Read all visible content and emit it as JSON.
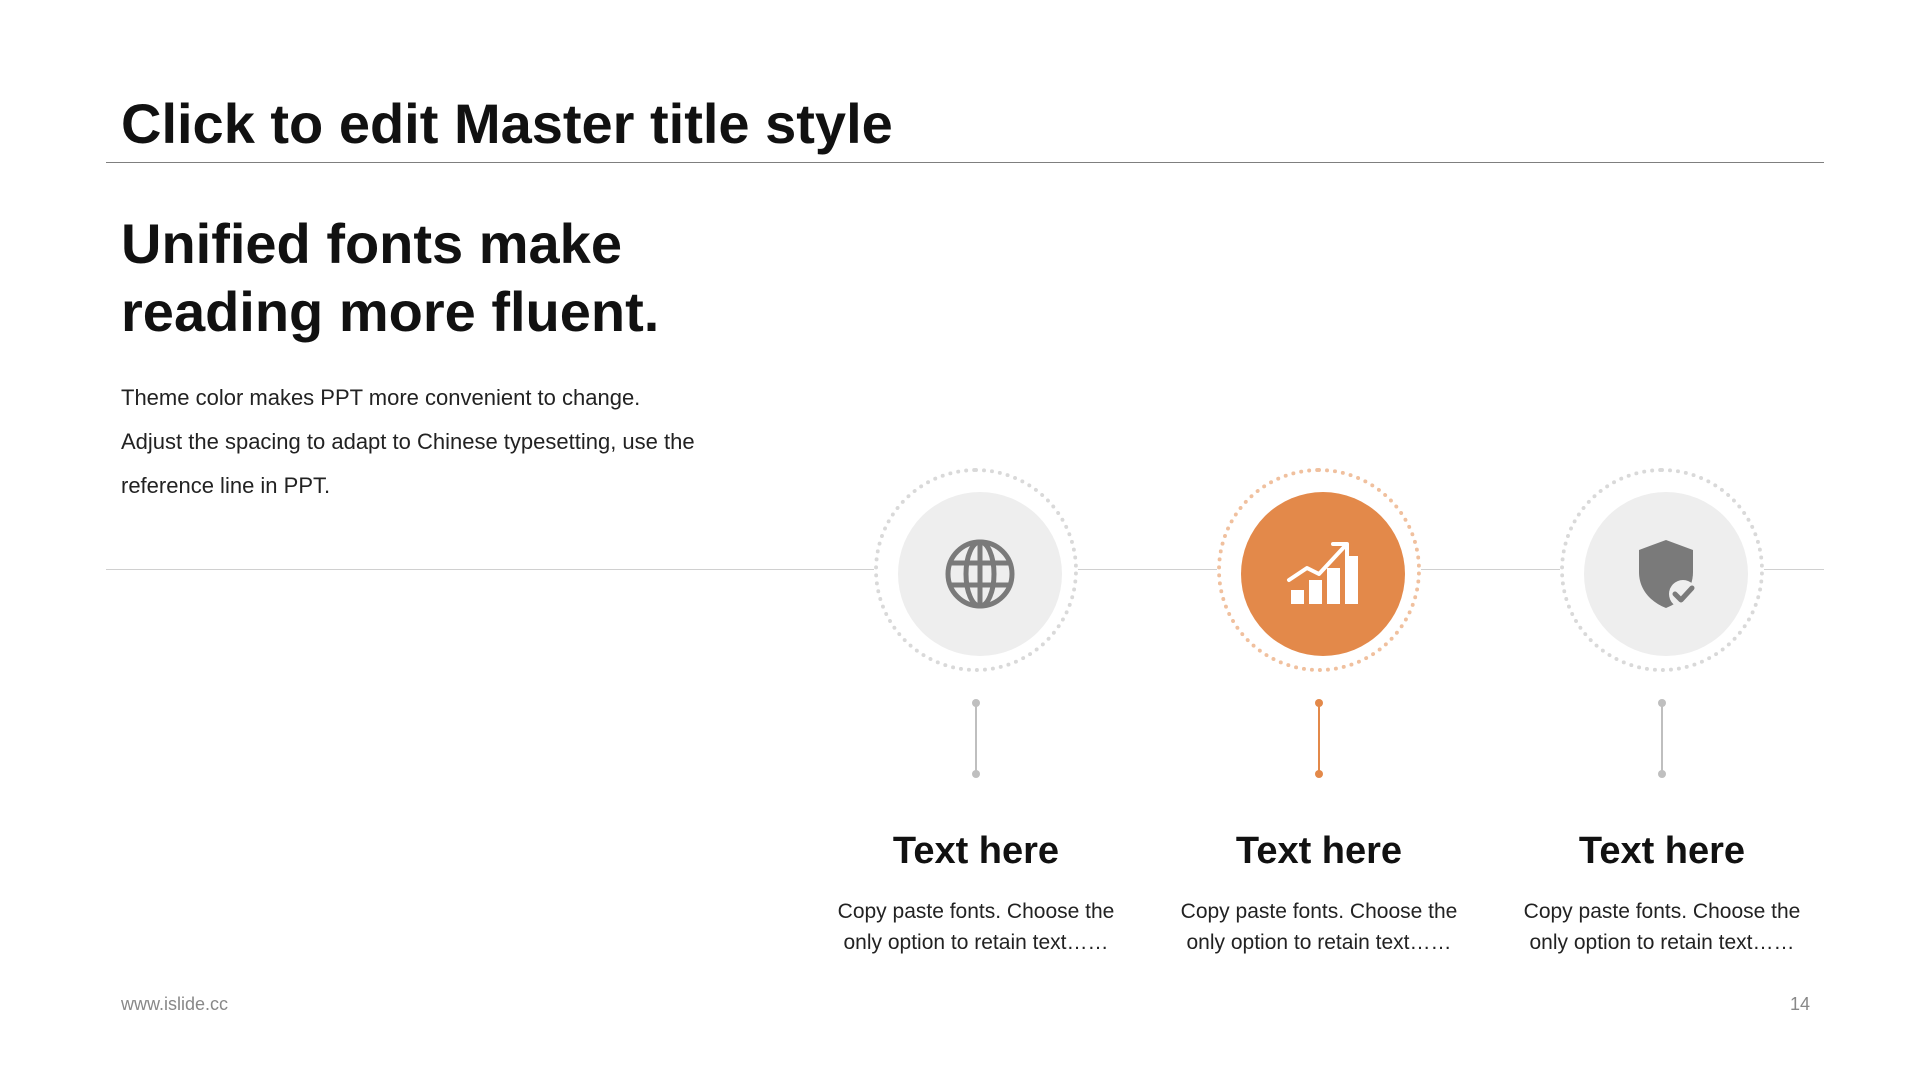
{
  "slide": {
    "master_title": "Click to edit Master title style",
    "headline_lines": [
      "Unified fonts make",
      "reading more fluent."
    ],
    "body_lines": [
      "Theme color makes PPT more convenient to change.",
      "Adjust the spacing to adapt to Chinese typesetting, use the",
      "reference line in PPT."
    ]
  },
  "features": [
    {
      "icon": "globe-icon",
      "title": "Text here",
      "desc_lines": [
        "Copy paste fonts. Choose the",
        "only option to retain text……"
      ]
    },
    {
      "icon": "bar-chart-growth-icon",
      "title": "Text here",
      "desc_lines": [
        "Copy paste fonts. Choose the",
        "only option to retain text……"
      ],
      "highlighted": true
    },
    {
      "icon": "shield-check-icon",
      "title": "Text here",
      "desc_lines": [
        "Copy paste fonts. Choose the",
        "only option to retain text……"
      ]
    }
  ],
  "footer": {
    "website": "www.islide.cc",
    "page_number": "14"
  },
  "colors": {
    "accent": "#e3894a",
    "neutral_disc": "#eeeeee",
    "neutral_icon": "#7a7a7a"
  }
}
